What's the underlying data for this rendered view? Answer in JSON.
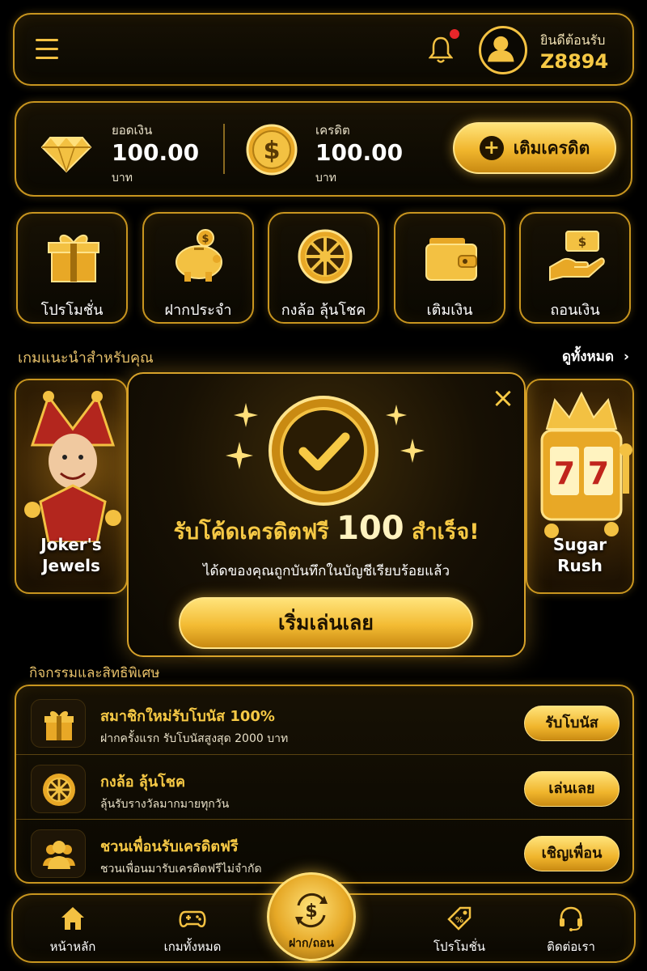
{
  "header": {
    "welcome": "ยินดีต้อนรับ",
    "username": "Z8894",
    "menu_icon": "hamburger-icon",
    "bell_icon": "bell-icon",
    "avatar_icon": "user-avatar-icon"
  },
  "balance": {
    "balance_label": "ยอดเงิน",
    "balance_value": "100.00",
    "balance_unit": "บาท",
    "credit_label": "เครดิต",
    "credit_value": "100.00",
    "credit_unit": "บาท",
    "topup_label": "เติมเครดิต"
  },
  "quick_actions": [
    {
      "label": "โปรโมชั่น",
      "icon": "gift-icon"
    },
    {
      "label": "ฝากประจำ",
      "icon": "piggy-bank-icon"
    },
    {
      "label": "กงล้อ ลุ้นโชค",
      "icon": "wheel-icon"
    },
    {
      "label": "เติมเงิน",
      "icon": "wallet-icon"
    },
    {
      "label": "ถอนเงิน",
      "icon": "cash-hand-icon"
    }
  ],
  "games_section": {
    "title": "เกมแนะนำสำหรับคุณ",
    "view_all": "ดูทั้งหมด",
    "games": [
      {
        "line1": "Joker's",
        "line2": "Jewels"
      },
      {
        "line1": "Sugar",
        "line2": "Rush"
      }
    ]
  },
  "modal": {
    "title_prefix": "รับโค้ดเครดิตฟรี",
    "title_amount": "100",
    "title_suffix": "สำเร็จ!",
    "subtitle": "ได้ดของคุณถูกบันทึกในบัญชีเรียบร้อยแล้ว",
    "play_button": "เริ่มเล่นเลย",
    "close_icon": "close-icon"
  },
  "activities": {
    "title": "กิจกรรมและสิทธิพิเศษ",
    "items": [
      {
        "title": "สมาชิกใหม่รับโบนัส 100%",
        "desc": "ฝากครั้งแรก รับโบนัสสูงสุด 2000 บาท",
        "button": "รับโบนัส",
        "icon": "gift-icon"
      },
      {
        "title": "กงล้อ ลุ้นโชค",
        "desc": "ลุ้นรับรางวัลมากมายทุกวัน",
        "button": "เล่นเลย",
        "icon": "wheel-icon"
      },
      {
        "title": "ชวนเพื่อนรับเครดิตฟรี",
        "desc": "ชวนเพื่อนมารับเครดิตฟรีไม่จำกัด",
        "button": "เชิญเพื่อน",
        "icon": "users-icon"
      }
    ]
  },
  "bottom_nav": {
    "home": "หน้าหลัก",
    "all_games": "เกมทั้งหมด",
    "deposit_withdraw": "ฝาก/ถอน",
    "promotions": "โปรโมชั่น",
    "contact": "ติดต่อเรา"
  },
  "colors": {
    "accent": "#f6c945",
    "border": "#c8951f",
    "background": "#000000"
  }
}
